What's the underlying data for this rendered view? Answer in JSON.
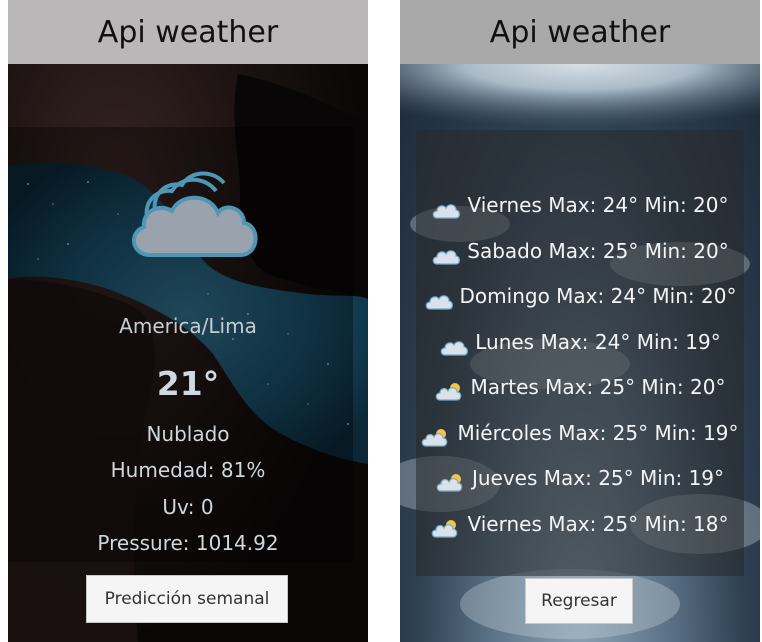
{
  "left": {
    "app_title": "Api weather",
    "weather_icon": "cloud-icon",
    "city": "America/Lima",
    "temperature": "21°",
    "condition": "Nublado",
    "humidity": "Humedad: 81%",
    "uv": "Uv: 0",
    "pressure": "Pressure: 1014.92",
    "forecast_button": "Predicción semanal"
  },
  "right": {
    "app_title": "Api weather",
    "forecast": [
      {
        "text": "Viernes Max: 24° Min: 20°",
        "icon": "cloud-icon"
      },
      {
        "text": "Sabado Max: 25° Min: 20°",
        "icon": "cloud-icon"
      },
      {
        "text": "Domingo Max: 24° Min: 20°",
        "icon": "cloud-icon"
      },
      {
        "text": "Lunes Max: 24° Min: 19°",
        "icon": "cloud-icon"
      },
      {
        "text": "Martes Max: 25° Min: 20°",
        "icon": "sun-cloud-icon"
      },
      {
        "text": "Miércoles Max: 25° Min: 19°",
        "icon": "sun-cloud-icon"
      },
      {
        "text": "Jueves Max: 25° Min: 19°",
        "icon": "sun-cloud-icon"
      },
      {
        "text": "Viernes Max: 25° Min: 18°",
        "icon": "sun-cloud-icon"
      }
    ],
    "back_button": "Regresar"
  }
}
